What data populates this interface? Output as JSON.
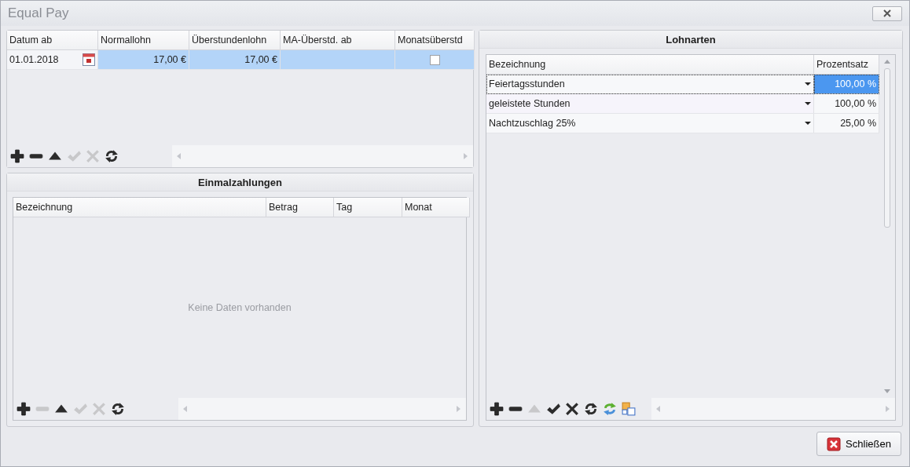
{
  "window": {
    "title": "Equal Pay"
  },
  "tarif": {
    "columns": [
      "Datum ab",
      "Normallohn",
      "Überstundenlohn",
      "MA-Überstd. ab",
      "Monatsüberstd"
    ],
    "rows": [
      {
        "selected": true,
        "datum_ab": "01.01.2018",
        "normallohn": "17,00 €",
        "ueberstundenlohn": "17,00 €",
        "monatsueberstd_checked": false
      }
    ],
    "toolbar": [
      {
        "kind": "add",
        "disabled": false
      },
      {
        "kind": "remove",
        "disabled": false
      },
      {
        "kind": "up",
        "disabled": false
      },
      {
        "kind": "confirm",
        "disabled": true
      },
      {
        "kind": "cancel",
        "disabled": true
      },
      {
        "kind": "refresh",
        "disabled": false
      }
    ]
  },
  "einmalzahlungen": {
    "title": "Einmalzahlungen",
    "columns": [
      "Bezeichnung",
      "Betrag",
      "Tag",
      "Monat"
    ],
    "empty_text": "Keine Daten vorhanden",
    "toolbar": [
      {
        "kind": "add",
        "disabled": false
      },
      {
        "kind": "remove",
        "disabled": true
      },
      {
        "kind": "up",
        "disabled": false
      },
      {
        "kind": "confirm",
        "disabled": true
      },
      {
        "kind": "cancel",
        "disabled": true
      },
      {
        "kind": "refresh",
        "disabled": false
      }
    ]
  },
  "lohnarten": {
    "title": "Lohnarten",
    "columns": [
      "Bezeichnung",
      "Prozentsatz"
    ],
    "rows": [
      {
        "selected": true,
        "bezeichnung": "Feiertagsstunden",
        "prozentsatz": "100,00 %"
      },
      {
        "selected": false,
        "bezeichnung": "geleistete Stunden",
        "prozentsatz": "100,00 %"
      },
      {
        "selected": false,
        "bezeichnung": "Nachtzuschlag 25%",
        "prozentsatz": "25,00 %"
      }
    ],
    "toolbar": [
      {
        "kind": "add",
        "disabled": false
      },
      {
        "kind": "remove",
        "disabled": false
      },
      {
        "kind": "up",
        "disabled": true
      },
      {
        "kind": "confirm",
        "disabled": false
      },
      {
        "kind": "cancel",
        "disabled": false
      },
      {
        "kind": "refresh",
        "disabled": false
      },
      {
        "kind": "sync",
        "disabled": false
      },
      {
        "kind": "copy",
        "disabled": false
      }
    ]
  },
  "close_button": {
    "label": "Schließen"
  }
}
